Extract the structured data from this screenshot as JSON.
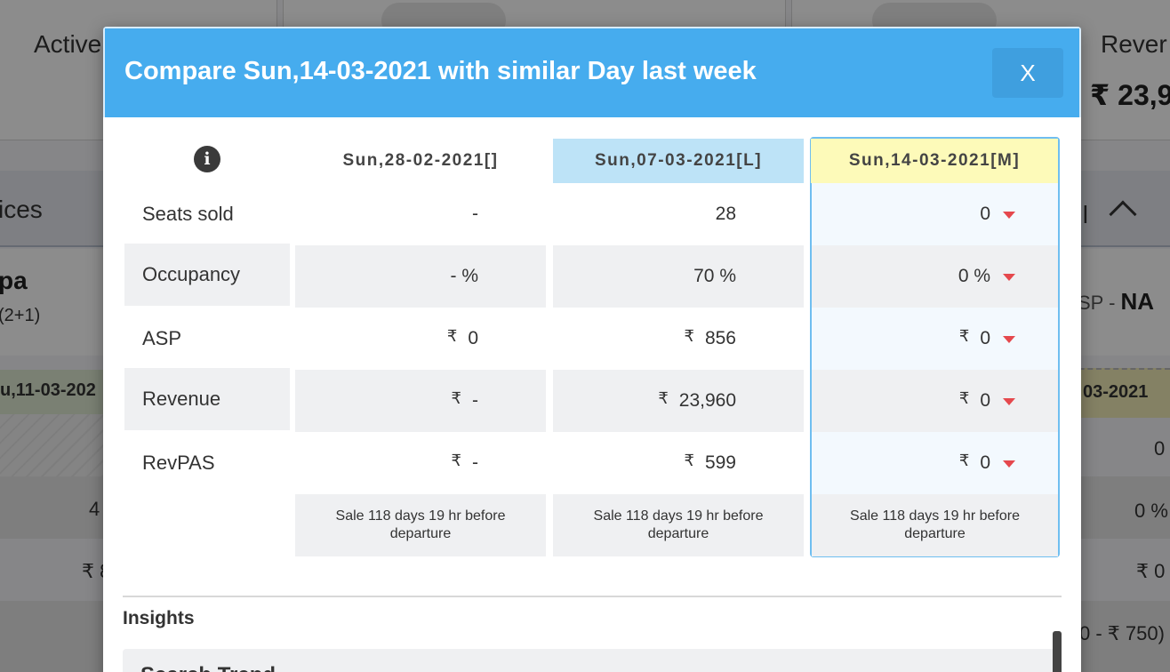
{
  "background": {
    "active_label": "Active",
    "revenue_label": "Rever",
    "revenue_value": "₹ 23,9",
    "band_left": "ices",
    "band_right": "all",
    "row_title": "pa",
    "row_sub": "(2+1)",
    "asp_label": "SP - ",
    "asp_value": "NA",
    "date_left": "u,11-03-202",
    "date_right": "03-2021",
    "right_val_1": "0",
    "left_val_2": "4",
    "right_val_2": "0 %",
    "left_val_3": "₹ 8",
    "right_val_3": "₹ 0",
    "right_val_4": "0 - ₹ 750)"
  },
  "modal": {
    "title": "Compare Sun,14-03-2021 with similar Day last week",
    "close_label": "X",
    "info_icon": "info-icon",
    "columns": [
      {
        "date": "Sun,28-02-2021",
        "tag": "[]"
      },
      {
        "date": "Sun,07-03-2021",
        "tag": "[L]"
      },
      {
        "date": "Sun,14-03-2021",
        "tag": "[M]"
      }
    ],
    "rows": [
      {
        "label": "Seats sold",
        "c1": "-",
        "c2": "28",
        "c3": "0"
      },
      {
        "label": "Occupancy",
        "c1": "- %",
        "c2": "70 %",
        "c3": "0 %"
      },
      {
        "label": "ASP",
        "c1": "0",
        "c2": "856",
        "c3": "0"
      },
      {
        "label": "Revenue",
        "c1": "-",
        "c2": "23,960",
        "c3": "0"
      },
      {
        "label": "RevPAS",
        "c1": "-",
        "c2": "599",
        "c3": "0"
      }
    ],
    "currency": "₹",
    "notes": [
      "Sale 118 days 19 hr before departure",
      "Sale 118 days 19 hr before departure",
      "Sale 118 days 19 hr before departure"
    ],
    "insights_heading": "Insights",
    "insight_card_title": "Search Trend",
    "colors": {
      "header": "#46acee",
      "prev_week_head": "#bde3f7",
      "current_head": "#fdfab9",
      "down_arrow": "#e5484d"
    }
  }
}
